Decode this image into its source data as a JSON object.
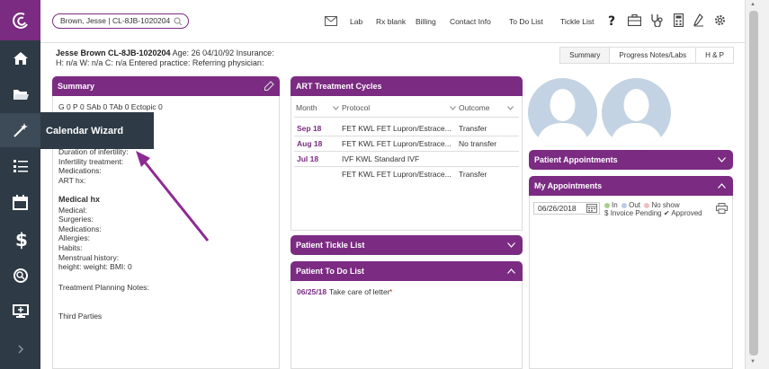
{
  "search": {
    "value": "Brown, Jesse | CL-8JB-1020204"
  },
  "topnav": {
    "lab": "Lab",
    "rx_blank": "Rx blank",
    "billing": "Billing",
    "contact_info": "Contact Info",
    "todo_list": "To Do List",
    "tickle_list": "Tickle List"
  },
  "tooltip": {
    "calendar_wizard": "Calendar Wizard"
  },
  "patient": {
    "name_id": "Jesse Brown CL-8JB-1020204",
    "details": " Age: 26 04/10/92 Insurance:",
    "line2": "H: n/a W: n/a C: n/a Entered practice: Referring physician:"
  },
  "tabs": [
    "Summary",
    "Progress Notes/Labs",
    "H & P"
  ],
  "summary": {
    "title": "Summary",
    "obstetric": "G 0 P 0 SAb 0 TAb 0 Ectopic 0",
    "fields": [
      "Duration of infertility:",
      "Infertility treatment:",
      "Medications:",
      "ART hx:"
    ],
    "medical_title": "Medical hx",
    "medical_fields": [
      "Medical:",
      "Surgeries:",
      "Medications:",
      "Allergies:",
      "Habits:",
      "Menstrual history:",
      "height: weight: BMI: 0"
    ],
    "treatment_planning": "Treatment Planning Notes:",
    "third_parties": "Third Parties"
  },
  "art": {
    "title": "ART Treatment Cycles",
    "columns": [
      "Month",
      "Protocol",
      "Outcome"
    ],
    "rows": [
      {
        "month": "Sep 18",
        "protocol": "FET KWL FET Lupron/Estrace...",
        "outcome": "Transfer"
      },
      {
        "month": "Aug 18",
        "protocol": "FET KWL FET Lupron/Estrace...",
        "outcome": "No transfer"
      },
      {
        "month": "Jul 18",
        "protocol": "IVF KWL Standard IVF",
        "outcome": ""
      },
      {
        "month": "",
        "protocol": "FET KWL FET Lupron/Estrace...",
        "outcome": "Transfer"
      }
    ]
  },
  "tickle": {
    "title": "Patient Tickle List"
  },
  "todo": {
    "title": "Patient To Do List",
    "items": [
      {
        "date": "06/25/18",
        "text": "Take care of letter",
        "marker": "*"
      }
    ]
  },
  "appointments": {
    "title": "Patient Appointments"
  },
  "my_appointments": {
    "title": "My Appointments",
    "date": "06/26/2018",
    "legend": {
      "in": "In",
      "out": "Out",
      "no_show": "No show",
      "invoice_pending": "Invoice Pending",
      "approved": "Approved"
    }
  },
  "colors": {
    "accent": "#7b2b82",
    "sidebar": "#2e3a45",
    "in": "#a8d08d",
    "out": "#b7cde6",
    "no_show": "#f0c0c0"
  }
}
